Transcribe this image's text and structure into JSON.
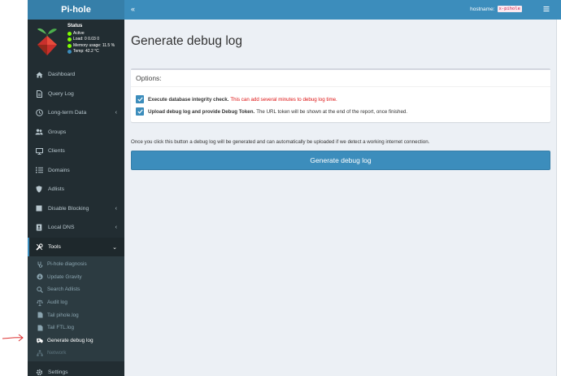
{
  "brand": "Pi-hole",
  "status": {
    "title": "Status",
    "active": "Active",
    "load": "Load:  0  0.03  0",
    "memory": "Memory usage:  11.5 %",
    "temp": "Temp: 42.2 °C"
  },
  "sidebar": {
    "items": [
      {
        "label": "Dashboard",
        "icon": "home-icon"
      },
      {
        "label": "Query Log",
        "icon": "file-icon"
      },
      {
        "label": "Long-term Data",
        "icon": "clock-icon"
      },
      {
        "label": "Groups",
        "icon": "users-icon"
      },
      {
        "label": "Clients",
        "icon": "monitor-icon"
      },
      {
        "label": "Domains",
        "icon": "list-icon"
      },
      {
        "label": "Adlists",
        "icon": "shield-icon"
      },
      {
        "label": "Disable Blocking",
        "icon": "stop-icon"
      },
      {
        "label": "Local DNS",
        "icon": "address-book-icon"
      },
      {
        "label": "Tools",
        "icon": "tools-icon"
      }
    ],
    "tools_sub": [
      {
        "label": "Pi-hole diagnosis",
        "icon": "stethoscope-icon"
      },
      {
        "label": "Update Gravity",
        "icon": "arrow-circle-icon"
      },
      {
        "label": "Search Adlists",
        "icon": "search-icon"
      },
      {
        "label": "Audit log",
        "icon": "balance-scale-icon"
      },
      {
        "label": "Tail pihole.log",
        "icon": "list-ul-icon"
      },
      {
        "label": "Tail FTL.log",
        "icon": "list-ul-icon"
      },
      {
        "label": "Generate debug log",
        "icon": "ambulance-icon"
      },
      {
        "label": "Network",
        "icon": "network-icon"
      }
    ],
    "settings": {
      "label": "Settings",
      "icon": "gear-icon"
    }
  },
  "header": {
    "hostname_label": "hostname:",
    "hostname_value": "x-pihole"
  },
  "main": {
    "title": "Generate debug log",
    "options_title": "Options:",
    "opt1_bold": "Execute database integrity check.",
    "opt1_warn": "This can add several minutes to debug log time.",
    "opt2_bold": "Upload debug log and provide Debug Token.",
    "opt2_text": "The URL token will be shown at the end of the report, once finished.",
    "info": "Once you click this button a debug log will be generated and can automatically be uploaded if we detect a working internet connection.",
    "button_label": "Generate debug log"
  },
  "colors": {
    "header_blue": "#3c8dbc",
    "brand_blue": "#367fa9",
    "sidebar_dark": "#222d32",
    "warning_red": "#dd1111"
  }
}
